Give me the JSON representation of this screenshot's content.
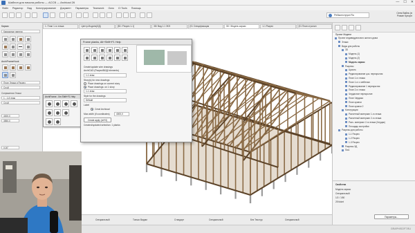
{
  "window": {
    "title": "Шаблон для начала работы — ACCB — Archicad 26",
    "controls": [
      "—",
      "☐",
      "✕"
    ]
  },
  "menu": [
    "Файл",
    "Редактор",
    "Вид",
    "Конструирование",
    "Документ",
    "Параметры",
    "Teamwork",
    "Окно",
    "CI Tools",
    "Помощь"
  ],
  "toolbar": {
    "user_badge": "Рейконструкт.Ru",
    "user_info_line1": "Сеня Вайль (в",
    "user_info_line2": "Роман Кухорн"
  },
  "tabs": [
    {
      "label": "1. План 1-го этажа",
      "active": false
    },
    {
      "label": "Центр-Модели(ИД)",
      "active": false
    },
    {
      "label": "[3D / Разрез 1-1]",
      "active": false
    },
    {
      "label": "3D/ Вид 1.1 ЗКЭ",
      "active": false
    },
    {
      "label": "[01 Спецификация",
      "active": false
    },
    {
      "label": "3D / Модель каркас",
      "active": true
    },
    {
      "label": "1-1 Разрез",
      "active": false
    },
    {
      "label": "[01 План стропил",
      "active": false
    }
  ],
  "toolbox": {
    "heading_top": "Каркас",
    "select_label": "Каркасные панели",
    "tool_group_label": "ArchiFrameHook",
    "field1": "План Этажа и Разрез",
    "field2": "Слой",
    "section_label": "Сопряжения Этажи",
    "field3": "1 - 1-й этаж",
    "field4": "Слой",
    "value1": "4000,0",
    "value2": "3550,0",
    "value3": "0,00°"
  },
  "palette": {
    "title": "ArchiFrame - 0m Shift+F1 Help"
  },
  "dialog": {
    "title": "Frame planks, Alt+Shift+F1 Help",
    "section1": "Create/update wire drawings",
    "section1_sub": "ArchiCAD (Разрез/ВИД/ elements)",
    "field_story": "1-1 этаж",
    "option_heading": "Story(s) for new drawings",
    "option1": "Place drawings on current story",
    "option2": "Place drawings: on 1 story",
    "story_value": "1-1 этаж",
    "style_heading": "Style for the drawings",
    "style_value": "Default",
    "field_label_2": "Label",
    "checkbox_label": "Creat Archicad",
    "max_width_label": "Max width (if coordinates)",
    "max_width_value": "4000,0",
    "create_button": "Create apply (ref+0)",
    "footer": "Created/updated selection: 1 planks"
  },
  "navigator": {
    "title": "Проект Модели",
    "header_label": "Название: Проект индивидуального жилого дома",
    "rows": [
      {
        "label": "Проект индивидуального жилого дома",
        "indent": 0,
        "bold": false
      },
      {
        "label": "Этажи",
        "indent": 1,
        "bold": false
      },
      {
        "label": "Виды для работы",
        "indent": 1,
        "bold": false
      },
      {
        "label": "3D",
        "indent": 2,
        "bold": false
      },
      {
        "label": "Модель (1)",
        "indent": 3,
        "bold": false
      },
      {
        "label": "Модель (2)",
        "indent": 3,
        "bold": false
      },
      {
        "label": "Модель каркас",
        "indent": 3,
        "bold": true
      },
      {
        "label": "Разрезы",
        "indent": 2,
        "bold": false
      },
      {
        "label": "Цоколь",
        "indent": 3,
        "bold": false
      },
      {
        "label": "Редактирование цок. перекрытия",
        "indent": 3,
        "bold": false
      },
      {
        "label": "План 1-го этажа",
        "indent": 3,
        "bold": false
      },
      {
        "label": "План 1-го с мебелью",
        "indent": 3,
        "bold": false
      },
      {
        "label": "Редактирование 1 перекрытия",
        "indent": 3,
        "bold": false
      },
      {
        "label": "План 2-го этажа",
        "indent": 3,
        "bold": false
      },
      {
        "label": "Чердачное перекрытие",
        "indent": 3,
        "bold": false
      },
      {
        "label": "План Чердака",
        "indent": 3,
        "bold": false
      },
      {
        "label": "План кровли",
        "indent": 3,
        "bold": false
      },
      {
        "label": "План кровли 2",
        "indent": 3,
        "bold": false
      },
      {
        "label": "Конструкции",
        "indent": 2,
        "bold": false
      },
      {
        "label": "Расчетный материал 1-го этажа",
        "indent": 3,
        "bold": false
      },
      {
        "label": "Расчетный материал 2-го этажа",
        "indent": 3,
        "bold": false
      },
      {
        "label": "Расч. материал 2-го этажа (Чердак)",
        "indent": 3,
        "bold": false
      },
      {
        "label": "Площадь застройки",
        "indent": 3,
        "bold": false
      },
      {
        "label": "Разрезы для работы",
        "indent": 1,
        "bold": false
      },
      {
        "label": "1-1 Разрез",
        "indent": 3,
        "bold": false
      },
      {
        "label": "1-2 Разрез",
        "indent": 3,
        "bold": false
      },
      {
        "label": "1-3 Разрез",
        "indent": 3,
        "bold": false
      },
      {
        "label": "Разрезы 3Д",
        "indent": 2,
        "bold": false
      },
      {
        "label": "ПиА",
        "indent": 2,
        "bold": false
      }
    ]
  },
  "properties": {
    "title": "Свойства",
    "line1": "Модель каркас",
    "line2": "Специальный",
    "line3": "1/2 / 1/50",
    "line4": "25 ticket",
    "button": "Параметры..."
  },
  "statusbar": {
    "items": [
      "1/2",
      "0/0 m2",
      "1:50",
      "Специальный",
      "Только Видим",
      "Стандарт",
      "Специальный",
      "Без Текстур",
      "Специальный"
    ],
    "watermark": "GRAPHISOFT.RU"
  },
  "colors": {
    "frame_wood": "#8a6a45",
    "frame_dark": "#5c4328",
    "accent": "#3a6fb7"
  }
}
